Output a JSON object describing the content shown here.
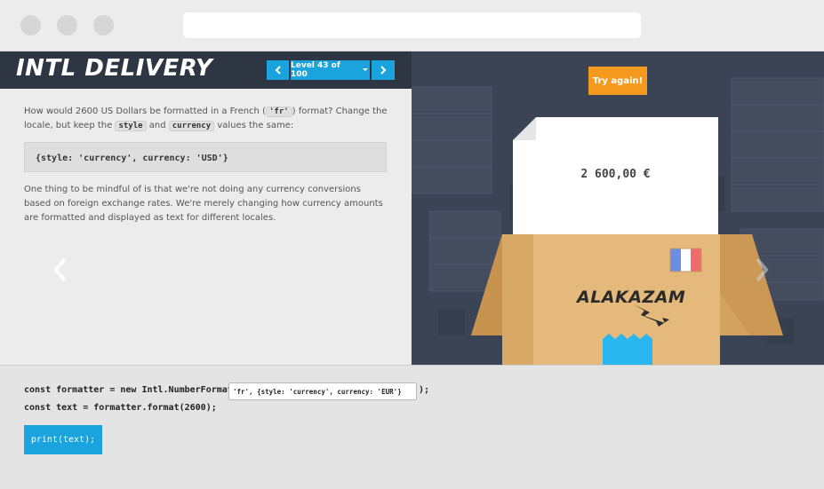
{
  "browser": {
    "url": ""
  },
  "header": {
    "title": "INTL DELIVERY",
    "prev_icon": "chevron-left",
    "level_label": "Level 43 of 100",
    "level_dropdown_icon": "caret-down",
    "next_icon": "chevron-right"
  },
  "instructions": {
    "p1_a": "How would 2600 US Dollars be formatted in a French (",
    "p1_code": "'fr'",
    "p1_b": ") format? Change the locale, but keep the",
    "p1_code_style": "style",
    "p1_and": "and",
    "p1_code_currency": "currency",
    "p1_c": "values the same:",
    "code_sample": "{style: 'currency', currency: 'USD'}",
    "p2": "One thing to be mindful of is that we're not doing any currency conversions based on foreign exchange rates. We're merely changing how currency amounts are formatted and displayed as text for different locales."
  },
  "scene": {
    "try_again_label": "Try again!",
    "paper_text": "2 600,00 €",
    "box_brand": "ALAKAZAM",
    "flag_colors": [
      "#6b8de3",
      "#ffffff",
      "#f06b6b"
    ],
    "box_color": "#e4b97b",
    "nav_left_icon": "chevron-left",
    "nav_right_icon": "chevron-right"
  },
  "editor": {
    "line1_prefix": "const formatter = new Intl.NumberFormat(",
    "input_value": "'fr', {style: 'currency', currency: 'EUR'}",
    "line1_suffix": ");",
    "line2": "const text = formatter.format(2600);",
    "run_label": "print(text);"
  },
  "colors": {
    "accent": "#1aa3dc",
    "try_again": "#f39a1f",
    "header_bg": "#2e3643",
    "scene_bg": "#3b4454"
  }
}
